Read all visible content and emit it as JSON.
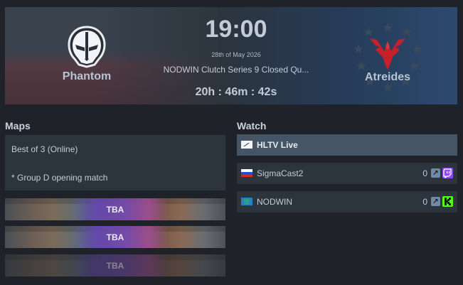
{
  "match": {
    "time": "19:00",
    "date": "28th of May 2026",
    "event": "NODWIN Clutch Series 9 Closed Qu...",
    "countdown": "20h : 46m : 42s",
    "team1": {
      "name": "Phantom",
      "logo": "phantom-logo"
    },
    "team2": {
      "name": "Atreides",
      "logo": "atreides-logo"
    }
  },
  "maps": {
    "title": "Maps",
    "info_line1": "Best of 3 (Online)",
    "info_line2": "* Group D opening match",
    "entries": [
      {
        "label": "TBA"
      },
      {
        "label": "TBA"
      },
      {
        "label": "TBA"
      }
    ]
  },
  "watch": {
    "title": "Watch",
    "streams": [
      {
        "name": "HLTV Live",
        "viewers": "",
        "flag": "hltv-icon"
      },
      {
        "name": "SigmaCast2",
        "viewers": "0",
        "flag": "russia-flag",
        "platform": "twitch-icon"
      },
      {
        "name": "NODWIN",
        "viewers": "0",
        "flag": "world-flag",
        "platform": "kick-icon"
      }
    ]
  },
  "colors": {
    "background": "#1f2329",
    "panel": "#2c343d",
    "hltv_row": "#455566",
    "twitch": "#9146ff",
    "kick": "#53fc18"
  }
}
